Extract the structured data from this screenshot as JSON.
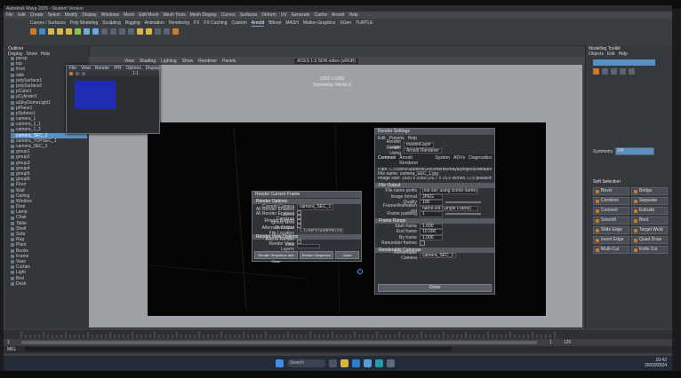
{
  "window": {
    "title": "Autodesk Maya 2025 - Student Version"
  },
  "menubar": {
    "items": [
      "File",
      "Edit",
      "Create",
      "Select",
      "Modify",
      "Display",
      "Windows",
      "Mesh",
      "Edit Mesh",
      "Mesh Tools",
      "Mesh Display",
      "Curves",
      "Surfaces",
      "Deform",
      "UV",
      "Generate",
      "Cache",
      "Arnold",
      "Help"
    ]
  },
  "shelf": {
    "tabs": [
      "Curves / Surfaces",
      "Poly Modeling",
      "Sculpting",
      "Rigging",
      "Animation",
      "Rendering",
      "FX",
      "FX Caching",
      "Custom",
      "Arnold",
      "Bifrost",
      "MASH",
      "Motion Graphics",
      "XGen",
      "TURTLE"
    ]
  },
  "outliner": {
    "title": "Outliner",
    "menu": [
      "Display",
      "Show",
      "Help"
    ],
    "items": [
      "persp",
      "top",
      "front",
      "side",
      "polySurface1",
      "polySurface2",
      "pCube1",
      "pCylinder1",
      "aiSkyDomeLight1",
      "pPlane1",
      "pSphere1",
      "camera_1",
      "camera_1_1",
      "camera_1_2",
      "camera_SEC_1",
      "camera_TOPSEC_1",
      "camera_SEC_2",
      "group1",
      "group2",
      "group3",
      "group4",
      "group5",
      "group6",
      "Floor",
      "Wall",
      "Ceiling",
      "Window",
      "Door",
      "Lamp",
      "Chair",
      "Table",
      "Shelf",
      "Sofa",
      "Rug",
      "Plant",
      "Books",
      "Frame",
      "Vase",
      "Curtain",
      "Light",
      "Bed",
      "Desk"
    ],
    "selected_index": 14
  },
  "viewport": {
    "menu": [
      "View",
      "Shading",
      "Lighting",
      "Show",
      "Renderer",
      "Panels"
    ],
    "camera_label": "ACES 1.0 SDR-video (sRGB)",
    "resolution_label": "1920 x 1080",
    "view_name": "Symmetry: World X"
  },
  "render_view": {
    "menu": [
      "File",
      "View",
      "Render",
      "IPR",
      "Options",
      "Display"
    ],
    "zoom": "1:1"
  },
  "render_settings": {
    "title": "Render Settings",
    "menu": [
      "Edit",
      "Presets",
      "Help"
    ],
    "render_layer_label": "Render Layer",
    "render_layer_value": "masterLayer",
    "render_using_label": "Render Using",
    "render_using_value": "Arnold Renderer",
    "tabs": [
      "Common",
      "Arnold Renderer",
      "System",
      "AOVs",
      "Diagnostics"
    ],
    "path_info": "Path: C:/Users/Student/Documents/maya/projects/default/images/",
    "file_name_info": "File name: camera_SEC_1.jpg",
    "image_size_info": "Image size: 1920 x 1080 (26.7 x 15.0 inches 72.0 pixels/inch)",
    "file_output": "File Output",
    "file_name_prefix_label": "File name prefix",
    "file_name_prefix_value": "(not set; using scene name)",
    "image_format_label": "Image format",
    "image_format_value": "JPEG",
    "quality_label": "Quality",
    "quality_value": "100",
    "frame_anim_label": "Frame/Animation ext",
    "frame_anim_value": "name.ext (Single Frame)",
    "frame_padding_label": "Frame padding",
    "frame_padding_value": "1",
    "frame_buffer_label": "Frame Range",
    "start_frame_label": "Start frame",
    "start_frame_value": "1.000",
    "end_frame_label": "End frame",
    "end_frame_value": "10.000",
    "by_frame_label": "By frame",
    "by_frame_value": "1.000",
    "renumber_label": "Renumber frames",
    "renderable_cameras": "Renderable Cameras",
    "renderable_camera_label": "Renderable Camera",
    "renderable_camera_value": "camera_SEC_1",
    "close_button": "Close"
  },
  "render_options": {
    "title": "Render Current Frame",
    "section_render": "Render Options",
    "current_camera_label": "Current Camera",
    "current_camera_value": "camera_SEC_1",
    "all_render_label": "All Render Enabled Layers",
    "all_enabled_label": "All Render Enabled Cameras",
    "render_region_label": "Render Region",
    "ignore_label": "Ignore Limit Overrides",
    "alt_output_label": "Alternate Output File Location",
    "alt_output_value": "C:/Users/Student/Documents/maya/projects/default/images",
    "section_view": "Render View Options",
    "add_to_label": "Add to Render View",
    "render_view_label": "Render View Layers",
    "buttons": [
      "Render Sequence and Close",
      "Render Sequence",
      "Close"
    ]
  },
  "right_panel": {
    "title": "Modeling Toolkit",
    "menu": [
      "Objects",
      "Edit",
      "Help"
    ],
    "symmetry_label": "Symmetry",
    "symmetry_value": "Off",
    "soft_selection": "Soft Selection",
    "tools": [
      "Bevel",
      "Bridge",
      "Combine",
      "Separate",
      "Connect",
      "Extrude",
      "Smooth",
      "Bool",
      "Slide Edge",
      "Target Weld",
      "Insert Edge",
      "Quad Draw",
      "Multi-Cut",
      "Knife Cut"
    ]
  },
  "range": {
    "start": "1",
    "end": "120",
    "current": "1"
  },
  "command": {
    "mode": "MEL"
  },
  "taskbar": {
    "search": "Search",
    "time": "10:42",
    "date": "20/03/2024"
  }
}
